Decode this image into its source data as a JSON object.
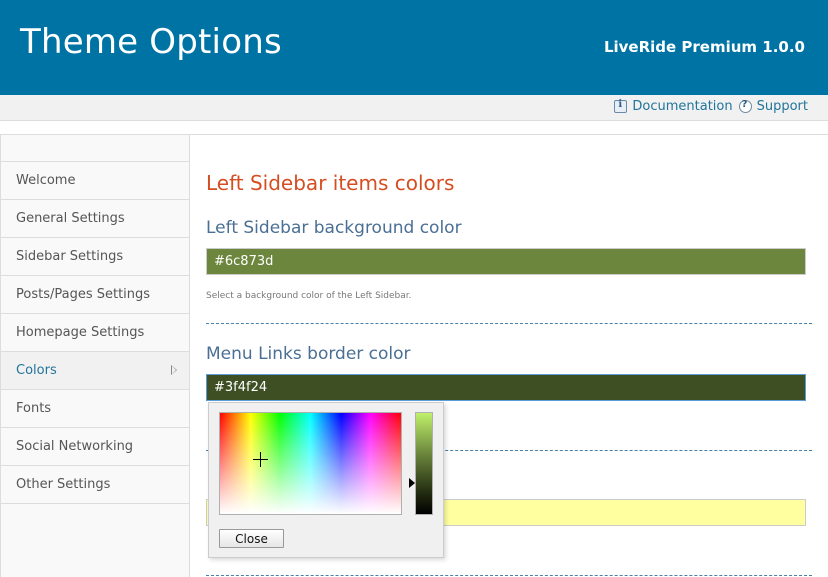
{
  "header": {
    "title": "Theme Options",
    "version": "LiveRide Premium 1.0.0"
  },
  "toolbar": {
    "documentation": "Documentation",
    "support": "Support"
  },
  "sidebar": {
    "items": [
      {
        "label": "Welcome"
      },
      {
        "label": "General Settings"
      },
      {
        "label": "Sidebar Settings"
      },
      {
        "label": "Posts/Pages Settings"
      },
      {
        "label": "Homepage Settings"
      },
      {
        "label": "Colors",
        "active": true
      },
      {
        "label": "Fonts"
      },
      {
        "label": "Social Networking"
      },
      {
        "label": "Other Settings"
      }
    ]
  },
  "main": {
    "section_title": "Left Sidebar items colors",
    "options": [
      {
        "label": "Left Sidebar background color",
        "value": "#6c873d",
        "description": "Select a background color of the Left Sidebar."
      },
      {
        "label": "Menu Links border color",
        "value": "#3f4f24"
      },
      {
        "value": ""
      }
    ]
  },
  "picker": {
    "close_label": "Close"
  },
  "colors": {
    "header_bg": "#0073a5",
    "section_title": "#d54e21",
    "label": "#4a6f94",
    "field1_bg": "#6c873d",
    "field2_bg": "#3f4f24",
    "field3_bg": "#ffffa0"
  }
}
